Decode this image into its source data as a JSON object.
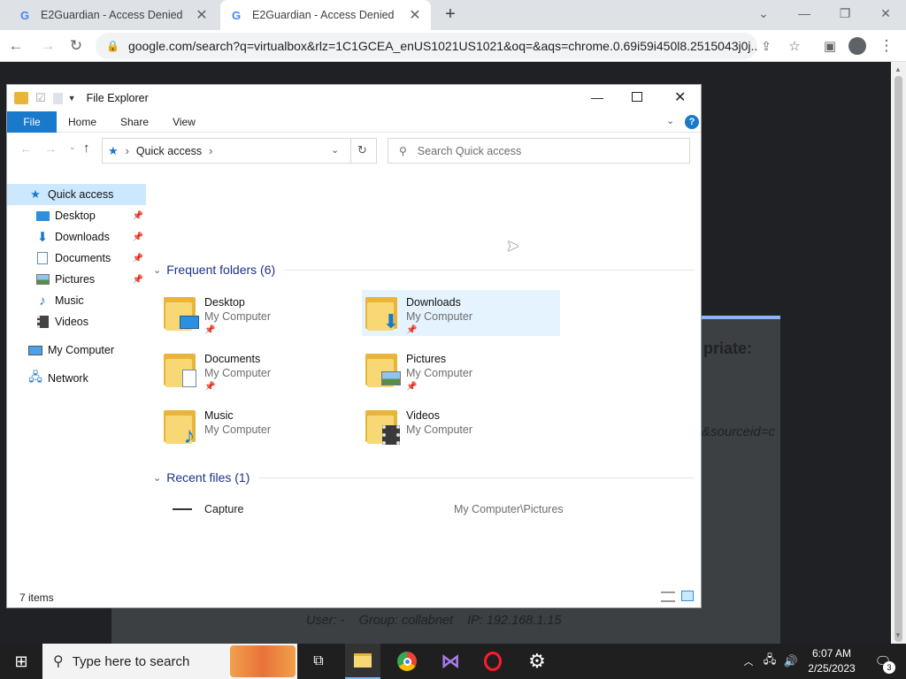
{
  "browser": {
    "tabs": [
      {
        "title": "E2Guardian - Access Denied",
        "icon": "google-g-icon"
      },
      {
        "title": "E2Guardian - Access Denied",
        "icon": "google-g-icon"
      }
    ],
    "url": "google.com/search?q=virtualbox&rlz=1C1GCEA_enUS1021US1021&oq=&aqs=chrome.0.69i59i450l8.2515043j0j..."
  },
  "page": {
    "partial_text_1": "priate:",
    "partial_text_2": "&sourceid=c",
    "footer": "User: -    Group: collabnet    IP: 192.168.1.15"
  },
  "explorer": {
    "title": "File Explorer",
    "ribbon_tabs": [
      "File",
      "Home",
      "Share",
      "View"
    ],
    "address": "Quick access",
    "search_placeholder": "Search Quick access",
    "nav": {
      "quick_access": "Quick access",
      "items": [
        {
          "label": "Desktop",
          "pinned": true
        },
        {
          "label": "Downloads",
          "pinned": true
        },
        {
          "label": "Documents",
          "pinned": true
        },
        {
          "label": "Pictures",
          "pinned": true
        },
        {
          "label": "Music",
          "pinned": false
        },
        {
          "label": "Videos",
          "pinned": false
        }
      ],
      "my_computer": "My Computer",
      "network": "Network"
    },
    "frequent_header": "Frequent folders (6)",
    "folders": [
      {
        "name": "Desktop",
        "location": "My Computer",
        "pinned": true
      },
      {
        "name": "Downloads",
        "location": "My Computer",
        "pinned": true
      },
      {
        "name": "Documents",
        "location": "My Computer",
        "pinned": true
      },
      {
        "name": "Pictures",
        "location": "My Computer",
        "pinned": true
      },
      {
        "name": "Music",
        "location": "My Computer",
        "pinned": false
      },
      {
        "name": "Videos",
        "location": "My Computer",
        "pinned": false
      }
    ],
    "recent_header": "Recent files (1)",
    "recent_files": [
      {
        "name": "Capture",
        "path": "My Computer\\Pictures"
      }
    ],
    "status": "7 items"
  },
  "taskbar": {
    "search_placeholder": "Type here to search",
    "time": "6:07 AM",
    "date": "2/25/2023",
    "notification_count": "3"
  },
  "colors": {
    "accent": "#1979ca",
    "selection": "#cce8ff",
    "folder": "#f8d775"
  }
}
